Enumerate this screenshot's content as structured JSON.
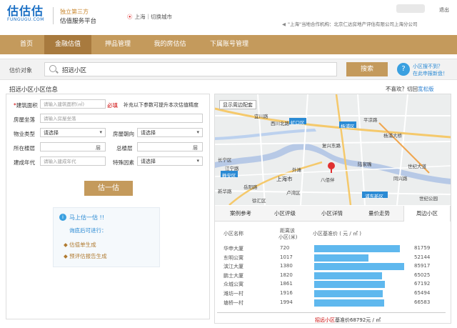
{
  "header": {
    "logo_text": "估估估",
    "logo_sub": "FUNGUGU.COM",
    "tagline_1": "独立第三方",
    "tagline_2": "估值服务平台",
    "location": "上海｜切换城市",
    "logout": "退出",
    "notice": "\"上海\"当地合作机构：北京仁达房地产评估有限公司上海分公司"
  },
  "nav": {
    "items": [
      "首页",
      "金融估值",
      "押品管理",
      "我的房估估",
      "下属账号管理"
    ]
  },
  "search": {
    "label": "估价对象",
    "value": "招远小区",
    "button": "搜索",
    "help_1": "小区搜不到？",
    "help_2": "在此申报新盘！"
  },
  "info": {
    "title": "招远小区小区信息",
    "not_like": "不喜欢？切回",
    "classic": "宽松版"
  },
  "form": {
    "area_label": "建筑面积",
    "area_placeholder": "请输入建筑面积(㎡)",
    "required": "必填",
    "hint": "补充以下参数可提升本次估值精度",
    "room_label": "房屋坐落",
    "room_placeholder": "请输入房屋坐落",
    "type_label": "物业类型",
    "select": "请选择",
    "orient_label": "房屋朝向",
    "floor_label": "所在楼层",
    "floor_unit": "层",
    "total_label": "总楼层",
    "year_label": "建成年代",
    "year_placeholder": "请输入建成年代",
    "special_label": "特殊因素",
    "submit": "估一估"
  },
  "tips": {
    "title": "马上估一估 !!",
    "sub": "询底后可进行：",
    "item_1": "估值单生成",
    "item_2": "预评估报告生成"
  },
  "map": {
    "show_nearby": "显示周边配套",
    "places": [
      "宜川路",
      "西川北路",
      "虹口区",
      "平凉路",
      "杨浦区",
      "杨浦大桥",
      "外滩",
      "长宁区",
      "江宁路",
      "陆家嘴",
      "静安区",
      "上海市",
      "八佰伴",
      "浦东新区",
      "世纪大道",
      "徐汇区",
      "岳阳路",
      "卢湾区",
      "新华路",
      "世纪公园",
      "复兴东路",
      "同兴路"
    ]
  },
  "tabs": [
    "案例参考",
    "小区评级",
    "小区详情",
    "量价走势",
    "周边小区"
  ],
  "nearby": {
    "col_name": "小区名称",
    "col_dist_1": "距离该",
    "col_dist_2": "小区(米)",
    "col_price": "小区基准价 ( 元 / ㎡ )",
    "rows": [
      {
        "name": "华申大厦",
        "dist": "720",
        "price": "81759",
        "level": 81759
      },
      {
        "name": "东明公寓",
        "dist": "1017",
        "price": "52144",
        "level": 52144
      },
      {
        "name": "滨江大厦",
        "dist": "1380",
        "price": "85917",
        "level": 85917
      },
      {
        "name": "鹏士大厦",
        "dist": "1820",
        "price": "65025",
        "level": 65025
      },
      {
        "name": "众城公寓",
        "dist": "1861",
        "price": "67192",
        "level": 67192
      },
      {
        "name": "潍坊一村",
        "dist": "1916",
        "price": "65494",
        "level": 65494
      },
      {
        "name": "塘桥一村",
        "dist": "1994",
        "price": "66583",
        "level": 66583
      }
    ],
    "footer_name": "招远小区",
    "footer_text": "基准价68792元 / ㎡"
  },
  "colors": {
    "brand": "#c49a5c",
    "brand_dark": "#a87a3e",
    "blue": "#1a6fc4",
    "bar": "#5fb8ee"
  }
}
